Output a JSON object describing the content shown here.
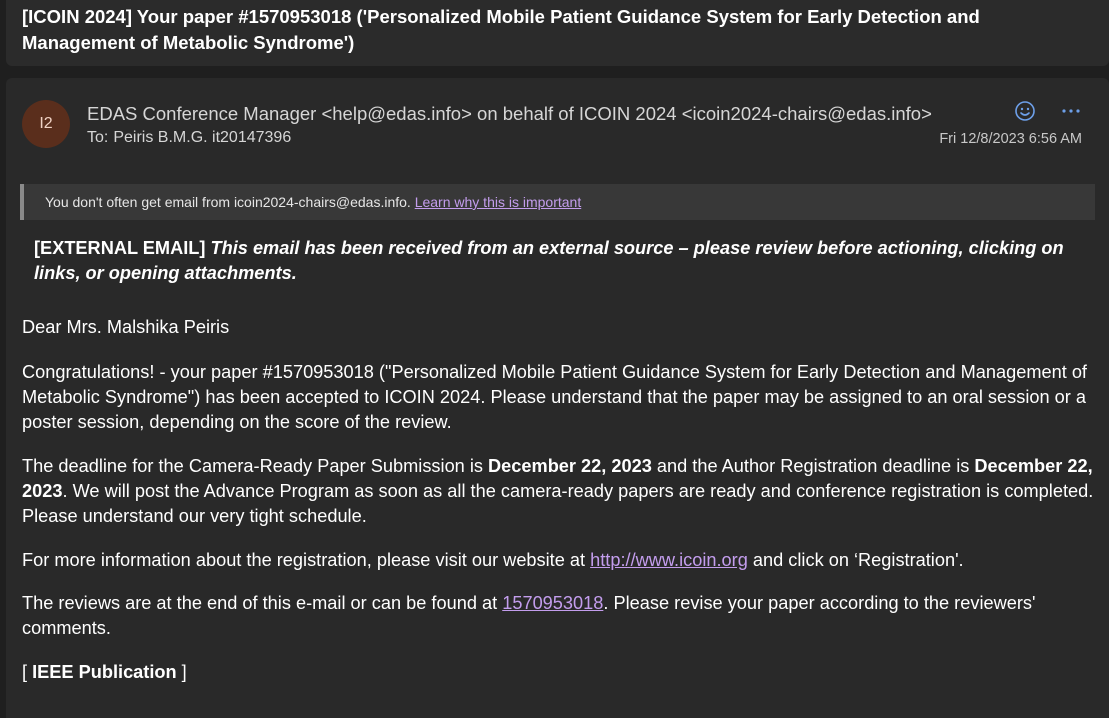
{
  "email": {
    "subject": "[ICOIN 2024] Your paper #1570953018 ('Personalized Mobile Patient Guidance System for Early Detection and Management of Metabolic Syndrome')",
    "avatar_initials": "I2",
    "sender": "EDAS Conference Manager <help@edas.info> on behalf of ICOIN 2024 <icoin2024-chairs@edas.info>",
    "to_label": "To:",
    "recipient": "Peiris B.M.G. it20147396",
    "date": "Fri 12/8/2023 6:56 AM",
    "reaction_icon": "smiley-icon",
    "more_icon": "more-icon"
  },
  "notice": {
    "text": "You don't often get email from icoin2024-chairs@edas.info.",
    "link": "Learn why this is important"
  },
  "external_banner": {
    "tag": "[EXTERNAL EMAIL]",
    "message": "This email has been received from an external source – please review before actioning, clicking on links, or opening attachments."
  },
  "body": {
    "greeting": "Dear Mrs. Malshika Peiris",
    "para1": "Congratulations! - your paper #1570953018 (\"Personalized Mobile Patient Guidance System for Early Detection and Management of Metabolic Syndrome\") has been accepted to ICOIN 2024. Please understand that the paper may be assigned to an oral session or a poster session, depending on the score of the review.",
    "para2_a": "The deadline for the Camera-Ready Paper Submission is ",
    "para2_date1": "December 22, 2023",
    "para2_b": " and the Author Registration deadline is ",
    "para2_date2": "December 22, 2023",
    "para2_c": ". We will post the Advance Program as soon as all the camera-ready papers are ready and conference registration is completed. Please understand our very tight schedule.",
    "para3_a": "For more information about the registration, please visit our website at ",
    "para3_link": "http://www.icoin.org",
    "para3_b": " and click on ‘Registration'.",
    "para4_a": "The reviews are at the end of this e-mail or can be found at ",
    "para4_link": "1570953018",
    "para4_b": ". Please revise your paper according to the reviewers' comments.",
    "section_open": "[ ",
    "section_title": "IEEE Publication",
    "section_close": " ]"
  },
  "colors": {
    "background": "#1f1f1f",
    "card": "#292929",
    "link": "#c39ded",
    "accent": "#6d9fe8",
    "avatar": "#5a2e1c"
  }
}
